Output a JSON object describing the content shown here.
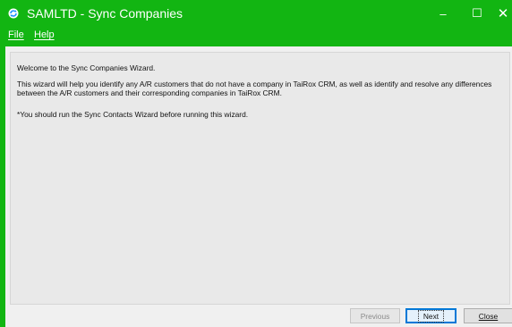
{
  "window": {
    "title": "SAMLTD - Sync Companies",
    "controls": {
      "minimize": "–",
      "maximize": "☐",
      "close": "✕"
    },
    "accent_color": "#12b512",
    "app_icon": "sync-app-icon"
  },
  "menu": {
    "items": [
      {
        "label": "File"
      },
      {
        "label": "Help"
      }
    ]
  },
  "content": {
    "paragraphs": [
      "Welcome to the Sync Companies Wizard.",
      "This wizard will help you identify any A/R customers that do not have a company in TaiRox CRM, as well as identify and resolve any differences between the A/R customers and their corresponding companies in TaiRox CRM.",
      "*You should run the Sync Contacts Wizard before running this wizard."
    ]
  },
  "buttons": {
    "previous": {
      "label": "Previous",
      "enabled": false
    },
    "next": {
      "label": "Next",
      "enabled": true
    },
    "close": {
      "label": "Close",
      "enabled": true
    }
  }
}
